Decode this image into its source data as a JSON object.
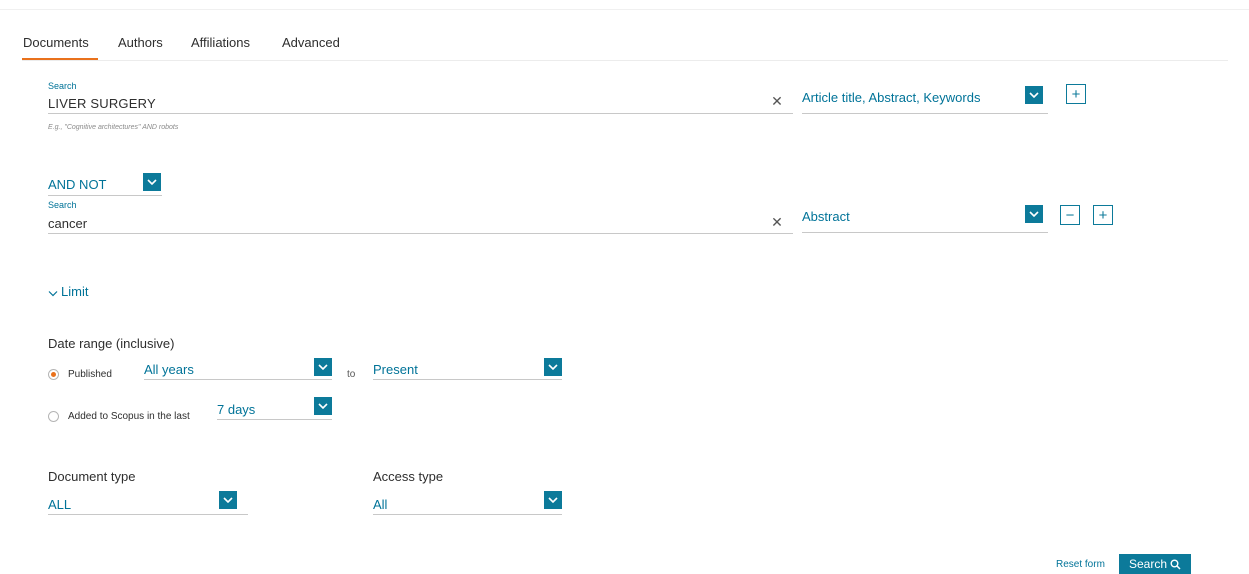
{
  "tabs": [
    {
      "label": "Documents",
      "active": true
    },
    {
      "label": "Authors",
      "active": false
    },
    {
      "label": "Affiliations",
      "active": false
    },
    {
      "label": "Advanced",
      "active": false
    }
  ],
  "search_rows": [
    {
      "label": "Search",
      "value": "LIVER SURGERY",
      "hint": "E.g., \"Cognitive architectures\" AND robots",
      "field": "Article title, Abstract, Keywords"
    },
    {
      "operator": "AND NOT",
      "label": "Search",
      "value": "cancer",
      "field": "Abstract"
    }
  ],
  "limit": {
    "toggle_label": "Limit",
    "date_range_title": "Date range (inclusive)",
    "published_label": "Published",
    "published_selected": true,
    "from_value": "All years",
    "to_label": "to",
    "to_value": "Present",
    "added_label": "Added to Scopus in the last",
    "added_value": "7 days",
    "document_type_title": "Document type",
    "document_type_value": "ALL",
    "access_type_title": "Access type",
    "access_type_value": "All"
  },
  "actions": {
    "reset_label": "Reset form",
    "search_label": "Search"
  },
  "colors": {
    "accent": "#0c7a9a",
    "link": "#007398",
    "active_tab": "#e9711c"
  }
}
